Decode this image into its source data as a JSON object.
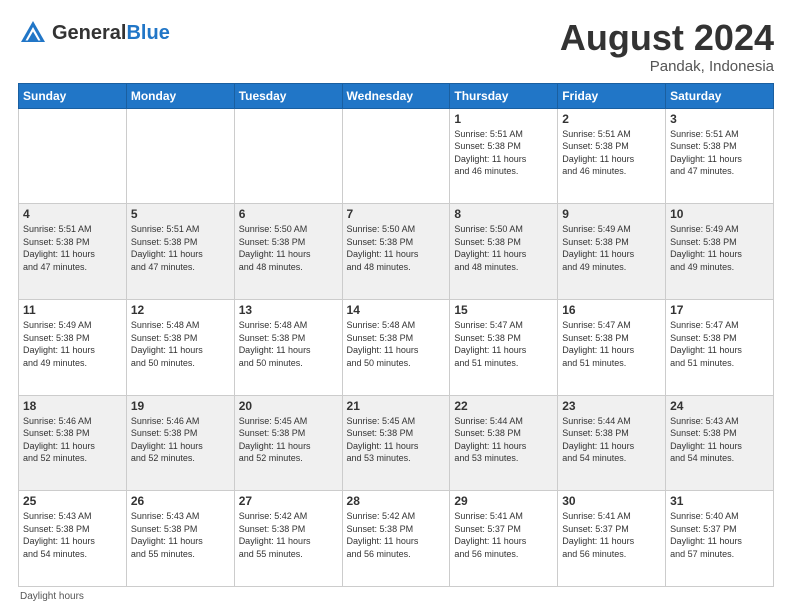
{
  "header": {
    "logo_general": "General",
    "logo_blue": "Blue",
    "month_year": "August 2024",
    "location": "Pandak, Indonesia"
  },
  "days_of_week": [
    "Sunday",
    "Monday",
    "Tuesday",
    "Wednesday",
    "Thursday",
    "Friday",
    "Saturday"
  ],
  "footer": "Daylight hours",
  "weeks": [
    [
      {
        "day": "",
        "info": ""
      },
      {
        "day": "",
        "info": ""
      },
      {
        "day": "",
        "info": ""
      },
      {
        "day": "",
        "info": ""
      },
      {
        "day": "1",
        "info": "Sunrise: 5:51 AM\nSunset: 5:38 PM\nDaylight: 11 hours\nand 46 minutes."
      },
      {
        "day": "2",
        "info": "Sunrise: 5:51 AM\nSunset: 5:38 PM\nDaylight: 11 hours\nand 46 minutes."
      },
      {
        "day": "3",
        "info": "Sunrise: 5:51 AM\nSunset: 5:38 PM\nDaylight: 11 hours\nand 47 minutes."
      }
    ],
    [
      {
        "day": "4",
        "info": "Sunrise: 5:51 AM\nSunset: 5:38 PM\nDaylight: 11 hours\nand 47 minutes."
      },
      {
        "day": "5",
        "info": "Sunrise: 5:51 AM\nSunset: 5:38 PM\nDaylight: 11 hours\nand 47 minutes."
      },
      {
        "day": "6",
        "info": "Sunrise: 5:50 AM\nSunset: 5:38 PM\nDaylight: 11 hours\nand 48 minutes."
      },
      {
        "day": "7",
        "info": "Sunrise: 5:50 AM\nSunset: 5:38 PM\nDaylight: 11 hours\nand 48 minutes."
      },
      {
        "day": "8",
        "info": "Sunrise: 5:50 AM\nSunset: 5:38 PM\nDaylight: 11 hours\nand 48 minutes."
      },
      {
        "day": "9",
        "info": "Sunrise: 5:49 AM\nSunset: 5:38 PM\nDaylight: 11 hours\nand 49 minutes."
      },
      {
        "day": "10",
        "info": "Sunrise: 5:49 AM\nSunset: 5:38 PM\nDaylight: 11 hours\nand 49 minutes."
      }
    ],
    [
      {
        "day": "11",
        "info": "Sunrise: 5:49 AM\nSunset: 5:38 PM\nDaylight: 11 hours\nand 49 minutes."
      },
      {
        "day": "12",
        "info": "Sunrise: 5:48 AM\nSunset: 5:38 PM\nDaylight: 11 hours\nand 50 minutes."
      },
      {
        "day": "13",
        "info": "Sunrise: 5:48 AM\nSunset: 5:38 PM\nDaylight: 11 hours\nand 50 minutes."
      },
      {
        "day": "14",
        "info": "Sunrise: 5:48 AM\nSunset: 5:38 PM\nDaylight: 11 hours\nand 50 minutes."
      },
      {
        "day": "15",
        "info": "Sunrise: 5:47 AM\nSunset: 5:38 PM\nDaylight: 11 hours\nand 51 minutes."
      },
      {
        "day": "16",
        "info": "Sunrise: 5:47 AM\nSunset: 5:38 PM\nDaylight: 11 hours\nand 51 minutes."
      },
      {
        "day": "17",
        "info": "Sunrise: 5:47 AM\nSunset: 5:38 PM\nDaylight: 11 hours\nand 51 minutes."
      }
    ],
    [
      {
        "day": "18",
        "info": "Sunrise: 5:46 AM\nSunset: 5:38 PM\nDaylight: 11 hours\nand 52 minutes."
      },
      {
        "day": "19",
        "info": "Sunrise: 5:46 AM\nSunset: 5:38 PM\nDaylight: 11 hours\nand 52 minutes."
      },
      {
        "day": "20",
        "info": "Sunrise: 5:45 AM\nSunset: 5:38 PM\nDaylight: 11 hours\nand 52 minutes."
      },
      {
        "day": "21",
        "info": "Sunrise: 5:45 AM\nSunset: 5:38 PM\nDaylight: 11 hours\nand 53 minutes."
      },
      {
        "day": "22",
        "info": "Sunrise: 5:44 AM\nSunset: 5:38 PM\nDaylight: 11 hours\nand 53 minutes."
      },
      {
        "day": "23",
        "info": "Sunrise: 5:44 AM\nSunset: 5:38 PM\nDaylight: 11 hours\nand 54 minutes."
      },
      {
        "day": "24",
        "info": "Sunrise: 5:43 AM\nSunset: 5:38 PM\nDaylight: 11 hours\nand 54 minutes."
      }
    ],
    [
      {
        "day": "25",
        "info": "Sunrise: 5:43 AM\nSunset: 5:38 PM\nDaylight: 11 hours\nand 54 minutes."
      },
      {
        "day": "26",
        "info": "Sunrise: 5:43 AM\nSunset: 5:38 PM\nDaylight: 11 hours\nand 55 minutes."
      },
      {
        "day": "27",
        "info": "Sunrise: 5:42 AM\nSunset: 5:38 PM\nDaylight: 11 hours\nand 55 minutes."
      },
      {
        "day": "28",
        "info": "Sunrise: 5:42 AM\nSunset: 5:38 PM\nDaylight: 11 hours\nand 56 minutes."
      },
      {
        "day": "29",
        "info": "Sunrise: 5:41 AM\nSunset: 5:37 PM\nDaylight: 11 hours\nand 56 minutes."
      },
      {
        "day": "30",
        "info": "Sunrise: 5:41 AM\nSunset: 5:37 PM\nDaylight: 11 hours\nand 56 minutes."
      },
      {
        "day": "31",
        "info": "Sunrise: 5:40 AM\nSunset: 5:37 PM\nDaylight: 11 hours\nand 57 minutes."
      }
    ]
  ]
}
